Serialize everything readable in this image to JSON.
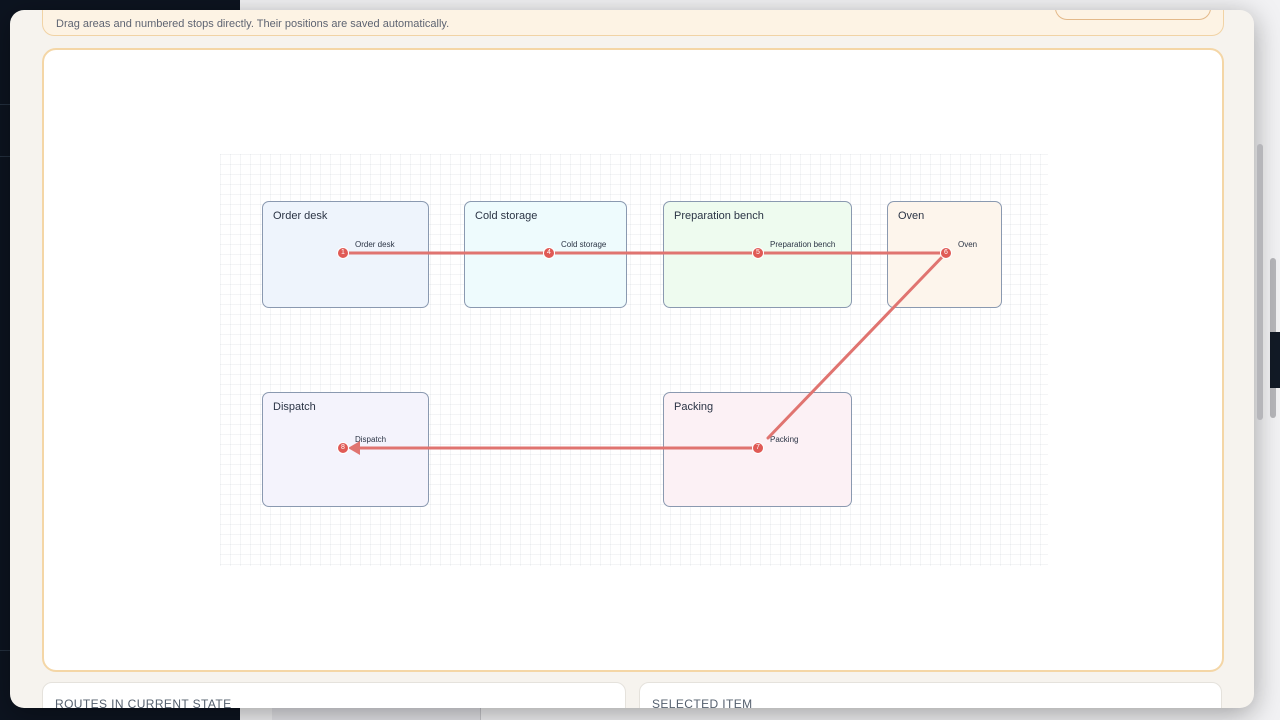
{
  "header": {
    "hint": "Drag areas and numbered stops directly. Their positions are saved automatically."
  },
  "areas": [
    {
      "id": "order-desk",
      "title": "Order desk",
      "fill": "#eef4fc"
    },
    {
      "id": "cold-storage",
      "title": "Cold storage",
      "fill": "#eefbfd"
    },
    {
      "id": "preparation-bench",
      "title": "Preparation bench",
      "fill": "#eefbef"
    },
    {
      "id": "oven",
      "title": "Oven",
      "fill": "#fdf5ec"
    },
    {
      "id": "dispatch",
      "title": "Dispatch",
      "fill": "#f4f3fc"
    },
    {
      "id": "packing",
      "title": "Packing",
      "fill": "#fcf1f5"
    }
  ],
  "stops": [
    {
      "number": "1",
      "label": "Order desk"
    },
    {
      "number": "4",
      "label": "Cold storage"
    },
    {
      "number": "5",
      "label": "Preparation bench"
    },
    {
      "number": "6",
      "label": "Oven"
    },
    {
      "number": "7",
      "label": "Packing"
    },
    {
      "number": "8",
      "label": "Dispatch"
    }
  ],
  "route": {
    "color": "#e07470",
    "stop_color": "#e05a55"
  },
  "panels": {
    "routes_title": "ROUTES IN CURRENT STATE",
    "selected_title": "SELECTED ITEM"
  }
}
